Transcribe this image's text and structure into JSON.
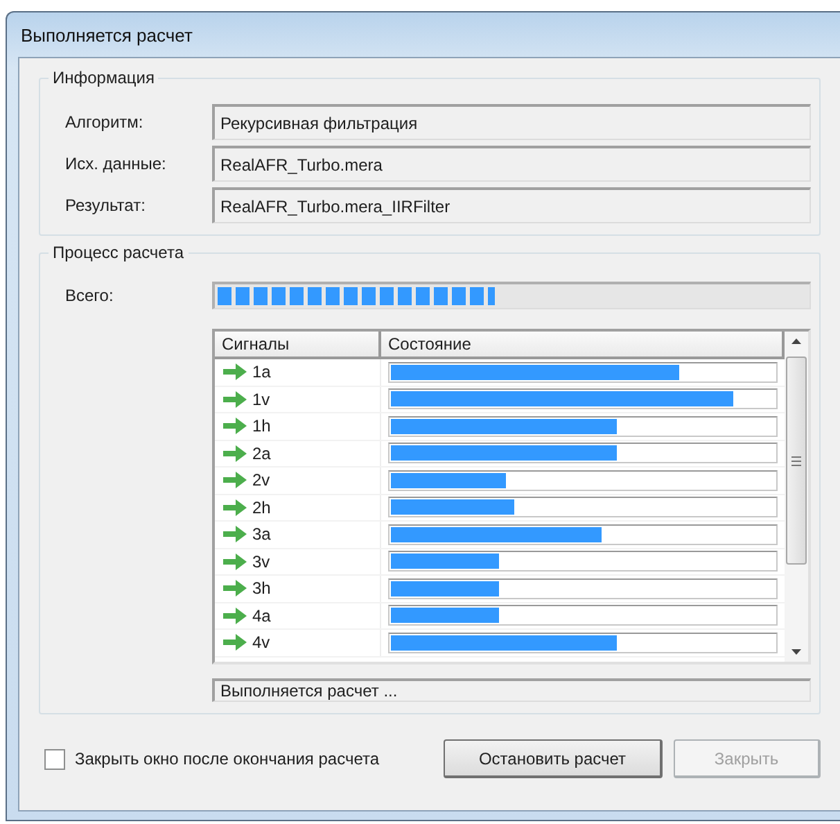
{
  "window": {
    "title": "Выполняется расчет"
  },
  "information": {
    "title": "Информация",
    "fields": [
      {
        "label": "Алгоритм:",
        "value": "Рекурсивная фильтрация"
      },
      {
        "label": "Исх. данные:",
        "value": "RealAFR_Turbo.mera"
      },
      {
        "label": "Результат:",
        "value": "RealAFR_Turbo.mera_IIRFilter"
      }
    ]
  },
  "process": {
    "title": "Процесс расчета",
    "total": {
      "label": "Всего:",
      "level": 0.47
    },
    "table": {
      "columns": [
        "Сигналы",
        "Состояние"
      ],
      "rows": [
        {
          "signal": "1a",
          "level": 0.75
        },
        {
          "signal": "1v",
          "level": 0.89
        },
        {
          "signal": "1h",
          "level": 0.59
        },
        {
          "signal": "2a",
          "level": 0.59
        },
        {
          "signal": "2v",
          "level": 0.3
        },
        {
          "signal": "2h",
          "level": 0.32
        },
        {
          "signal": "3a",
          "level": 0.55
        },
        {
          "signal": "3v",
          "level": 0.28
        },
        {
          "signal": "3h",
          "level": 0.28
        },
        {
          "signal": "4a",
          "level": 0.28
        },
        {
          "signal": "4v",
          "level": 0.59
        }
      ]
    },
    "status": "Выполняется расчет ..."
  },
  "close_after": {
    "label": "Закрыть окно после окончания расчета",
    "checked": false
  },
  "buttons": [
    {
      "label": "Остановить расчет",
      "disabled": false
    },
    {
      "label": "Закрыть",
      "disabled": true
    }
  ]
}
